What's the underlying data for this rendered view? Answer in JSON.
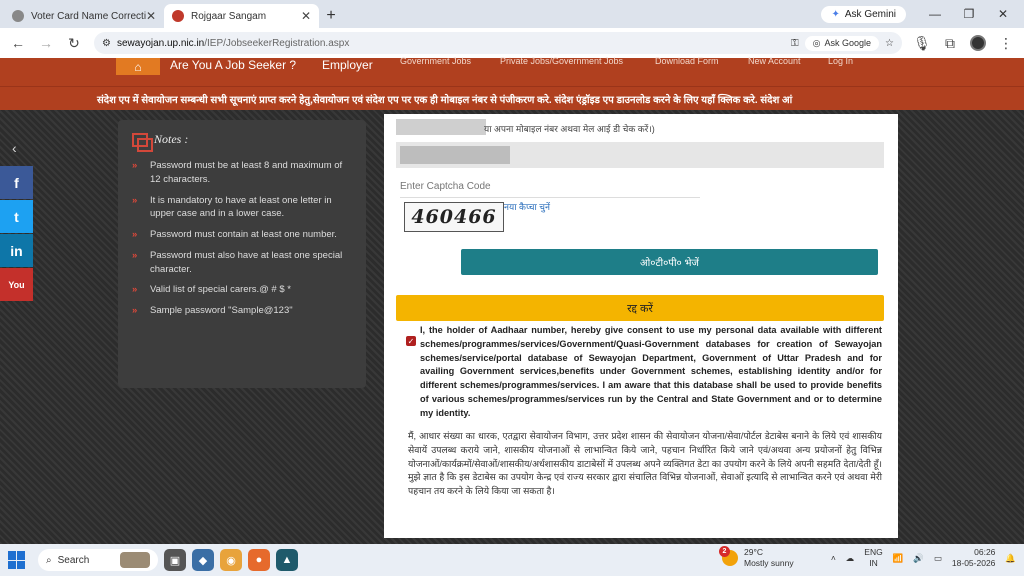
{
  "browser": {
    "tabs": [
      {
        "title": "Voter Card Name Correction",
        "close": "✕"
      },
      {
        "title": "Rojgaar Sangam",
        "close": "✕"
      }
    ],
    "new_tab": "+",
    "gemini": "Ask Gemini",
    "minimize": "—",
    "maximize": "❐",
    "close": "✕",
    "address": {
      "host": "sewayojan.up.nic.in",
      "path": "/IEP/JobseekerRegistration.aspx"
    },
    "ask_google": "Ask Google"
  },
  "site_nav": {
    "items": [
      "Are You A Job Seeker ?",
      "Employer"
    ],
    "faded_items": [
      "Government Jobs",
      "Private Jobs/Government Jobs",
      "Download Form",
      "New Account",
      "Log In"
    ]
  },
  "marquee": "संदेश एप में सेवायोजन सम्बन्धी सभी सूचनाएं प्राप्त करने हेतु,सेवायोजन एवं संदेश एप पर एक ही मोबाइल नंबर से पंजीकरण करे.  संदेश एंड्रॉइड एप डाउनलोड करने के लिए यहाँ क्लिक करे.    संदेश आं",
  "social": {
    "facebook": "f",
    "twitter": "t",
    "linkedin": "in",
    "youtube": "You"
  },
  "notes": {
    "title": "Notes :",
    "items": [
      "Password must be at least 8 and maximum of 12 characters.",
      "It is mandatory to have at least one letter in upper case and in a lower case.",
      "Password must contain at least one number.",
      "Password must also have at least one special character.",
      "Valid list of special carers.@ # $ *",
      "Sample password \"Sample@123\""
    ]
  },
  "form": {
    "hint": "या अपना मोबाइल नंबर अथवा मेल आई डी चेक करें।)",
    "captcha_placeholder": "Enter Captcha Code",
    "captcha_text": "460466",
    "new_captcha": "नया कैप्चा चुनें",
    "otp_button": "ओ०टी०पी० भेजें",
    "cancel_button": "रद्द करें",
    "consent_en": "I, the holder of Aadhaar number, hereby give consent to use my personal data available with different schemes/programmes/services/Government/Quasi-Government databases for creation of Sewayojan schemes/service/portal database of Sewayojan Department, Government of Uttar Pradesh and for availing Government services,benefits under Government schemes, establishing identity and/or for different schemes/programmes/services. I am aware that this database shall be used to provide benefits of various schemes/programmes/services run by the Central and State Government and or to determine my identity.",
    "consent_hi": "मैं, आधार संख्या का धारक, एतद्वारा सेवायोजन विभाग, उत्तर प्रदेश शासन की सेवायोजन योजना/सेवा/पोर्टल डेटाबेस बनाने के लिये एवं शासकीय सेवायें उपलब्ध कराये जाने, शासकीय योजनाओं से लाभान्वित किये जाने, पहचान निर्धारित किये जाने एवं/अथवा अन्य प्रयोजनों हेतु विभिन्न योजनाओं/कार्यक्रमों/सेवाओं/शासकीय/अर्धशासकीय डाटाबेसों में उपलब्ध अपने व्यक्तिगत डेटा का उपयोग करने के लिये अपनी सहमति देता/देती हूँ। मुझे ज्ञात है कि इस डेटाबेस का उपयोग केन्द्र एवं राज्य सरकार द्वारा संचालित विभिन्न योजनाओं, सेवाओं इत्यादि से लाभान्वित करने एवं अथवा मेरी पहचान तय करने के लिये किया जा सकता है।"
  },
  "taskbar": {
    "search": "Search",
    "weather_badge": "2",
    "temp": "29°C",
    "condition": "Mostly sunny",
    "lang": "ENG",
    "region": "IN",
    "time": "06:26",
    "date": "18-05-2026"
  }
}
